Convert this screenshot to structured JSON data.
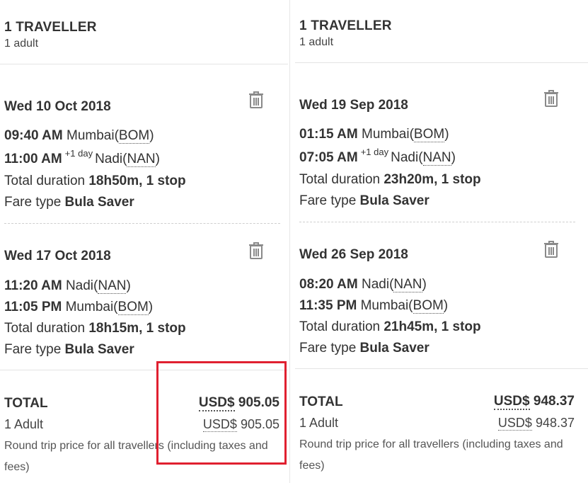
{
  "left": {
    "traveller": {
      "title": "1 TRAVELLER",
      "sub": "1 adult"
    },
    "outbound": {
      "date": "Wed 10 Oct 2018",
      "dep_time": "09:40 AM",
      "dep_city": "Mumbai(",
      "dep_code": "BOM",
      "dep_close": ")",
      "arr_time": "11:00 AM",
      "arr_day": "+1 day",
      "arr_city": "Nadi(",
      "arr_code": "NAN",
      "arr_close": ")",
      "duration_label": "Total duration",
      "duration": "18h50m, 1 stop",
      "fare_label": "Fare type",
      "fare": "Bula Saver"
    },
    "inbound": {
      "date": "Wed 17 Oct 2018",
      "dep_time": "11:20 AM",
      "dep_city": "Nadi(",
      "dep_code": "NAN",
      "dep_close": ")",
      "arr_time": "11:05 PM",
      "arr_city": "Mumbai(",
      "arr_code": "BOM",
      "arr_close": ")",
      "duration_label": "Total duration",
      "duration": "18h15m, 1 stop",
      "fare_label": "Fare type",
      "fare": "Bula Saver"
    },
    "total": {
      "label": "TOTAL",
      "currency": "USD$",
      "amount": "905.05",
      "adult_label": "1 Adult",
      "adult_currency": "USD$",
      "adult_amount": "905.05",
      "note": "Round trip price for all travellers (including taxes and fees)"
    }
  },
  "right": {
    "traveller": {
      "title": "1 TRAVELLER",
      "sub": "1 adult"
    },
    "outbound": {
      "date": "Wed 19 Sep 2018",
      "dep_time": "01:15 AM",
      "dep_city": "Mumbai(",
      "dep_code": "BOM",
      "dep_close": ")",
      "arr_time": "07:05 AM",
      "arr_day": "+1 day",
      "arr_city": "Nadi(",
      "arr_code": "NAN",
      "arr_close": ")",
      "duration_label": "Total duration",
      "duration": "23h20m, 1 stop",
      "fare_label": "Fare type",
      "fare": "Bula Saver"
    },
    "inbound": {
      "date": "Wed 26 Sep 2018",
      "dep_time": "08:20 AM",
      "dep_city": "Nadi(",
      "dep_code": "NAN",
      "dep_close": ")",
      "arr_time": "11:35 PM",
      "arr_city": "Mumbai(",
      "arr_code": "BOM",
      "arr_close": ")",
      "duration_label": "Total duration",
      "duration": "21h45m, 1 stop",
      "fare_label": "Fare type",
      "fare": "Bula Saver"
    },
    "total": {
      "label": "TOTAL",
      "currency": "USD$",
      "amount": "948.37",
      "adult_label": "1 Adult",
      "adult_currency": "USD$",
      "adult_amount": "948.37",
      "note": "Round trip price for all travellers (including taxes and fees)"
    }
  },
  "icons": {
    "delete": "trash-icon"
  },
  "colors": {
    "highlight": "#e02030",
    "text": "#333333",
    "trash": "#8a8a8a"
  }
}
